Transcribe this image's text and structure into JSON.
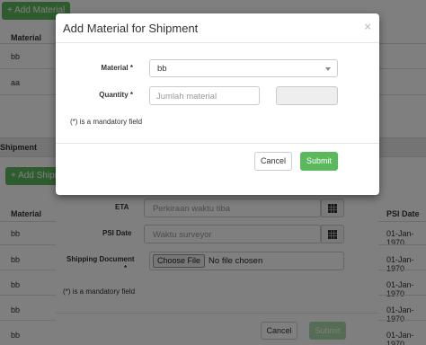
{
  "background": {
    "add_material_button": "+ Add Material",
    "material_header": "Material",
    "rows_top": [
      "bb",
      "aa"
    ],
    "shipment_section": "Shipment",
    "add_shipment_button": "+ Add Shipment",
    "shipment_header_material": "Material",
    "shipment_header_psi": "PSI Date",
    "shipment_rows": [
      {
        "material": "bb",
        "psi_date": "01-Jan-1970"
      },
      {
        "material": "bb",
        "psi_date": "01-Jan-1970"
      },
      {
        "material": "bb",
        "psi_date": "01-Jan-1970"
      },
      {
        "material": "bb",
        "psi_date": "01-Jan-1970"
      },
      {
        "material": "bb",
        "psi_date": "01-Jan-1970"
      }
    ]
  },
  "lower_modal": {
    "eta_label": "ETA",
    "eta_placeholder": "Perkiraan waktu tiba",
    "psi_label": "PSI Date",
    "psi_placeholder": "Waktu surveyor",
    "doc_label": "Shipping Document",
    "doc_required": "*",
    "file_button": "Choose File",
    "file_status": "No file chosen",
    "note": "(*) is a mandatory field",
    "cancel": "Cancel",
    "submit": "Submit"
  },
  "modal": {
    "title": "Add Material for Shipment",
    "close": "×",
    "material_label": "Material *",
    "material_value": "bb",
    "quantity_label": "Quantity *",
    "quantity_placeholder": "Jumlah material",
    "note": "(*) is a mandatory field",
    "cancel": "Cancel",
    "submit": "Submit"
  },
  "colors": {
    "primary_green": "#5cb85c",
    "backdrop": "rgba(0,0,0,0.5)"
  },
  "icons": [
    "calendar-icon",
    "chevron-down-icon",
    "close-icon"
  ]
}
